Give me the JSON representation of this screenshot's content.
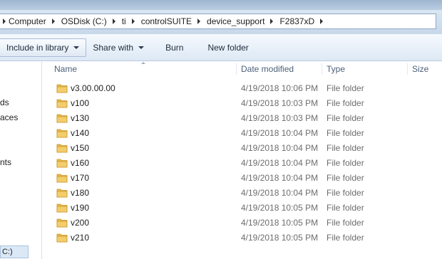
{
  "address_bar": {
    "breadcrumbs": [
      "Computer",
      "OSDisk (C:)",
      "ti",
      "controlSUITE",
      "device_support",
      "F2837xD"
    ]
  },
  "toolbar": {
    "include_in_library": "Include in library",
    "share_with": "Share with",
    "burn": "Burn",
    "new_folder": "New folder"
  },
  "nav_pane": {
    "items": [
      "ds",
      "aces",
      "nts"
    ],
    "drive_label": "C:)"
  },
  "file_list": {
    "columns": [
      "Name",
      "Date modified",
      "Type",
      "Size"
    ],
    "rows": [
      {
        "name": "v3.00.00.00",
        "date": "4/19/2018 10:06 PM",
        "type": "File folder"
      },
      {
        "name": "v100",
        "date": "4/19/2018 10:03 PM",
        "type": "File folder"
      },
      {
        "name": "v130",
        "date": "4/19/2018 10:03 PM",
        "type": "File folder"
      },
      {
        "name": "v140",
        "date": "4/19/2018 10:04 PM",
        "type": "File folder"
      },
      {
        "name": "v150",
        "date": "4/19/2018 10:04 PM",
        "type": "File folder"
      },
      {
        "name": "v160",
        "date": "4/19/2018 10:04 PM",
        "type": "File folder"
      },
      {
        "name": "v170",
        "date": "4/19/2018 10:04 PM",
        "type": "File folder"
      },
      {
        "name": "v180",
        "date": "4/19/2018 10:04 PM",
        "type": "File folder"
      },
      {
        "name": "v190",
        "date": "4/19/2018 10:05 PM",
        "type": "File folder"
      },
      {
        "name": "v200",
        "date": "4/19/2018 10:05 PM",
        "type": "File folder"
      },
      {
        "name": "v210",
        "date": "4/19/2018 10:05 PM",
        "type": "File folder"
      }
    ]
  },
  "icons": {
    "folder": "folder-icon",
    "breadcrumb_separator": "chevron-right-icon",
    "dropdown": "chevron-down-icon"
  },
  "colors": {
    "folder": "#e8b84a",
    "toolbar_bg": "#dde9f5",
    "address_bar_bg": "#c7d8ea",
    "secondary_text": "#6d6d6d",
    "header_text": "#4c607a"
  }
}
